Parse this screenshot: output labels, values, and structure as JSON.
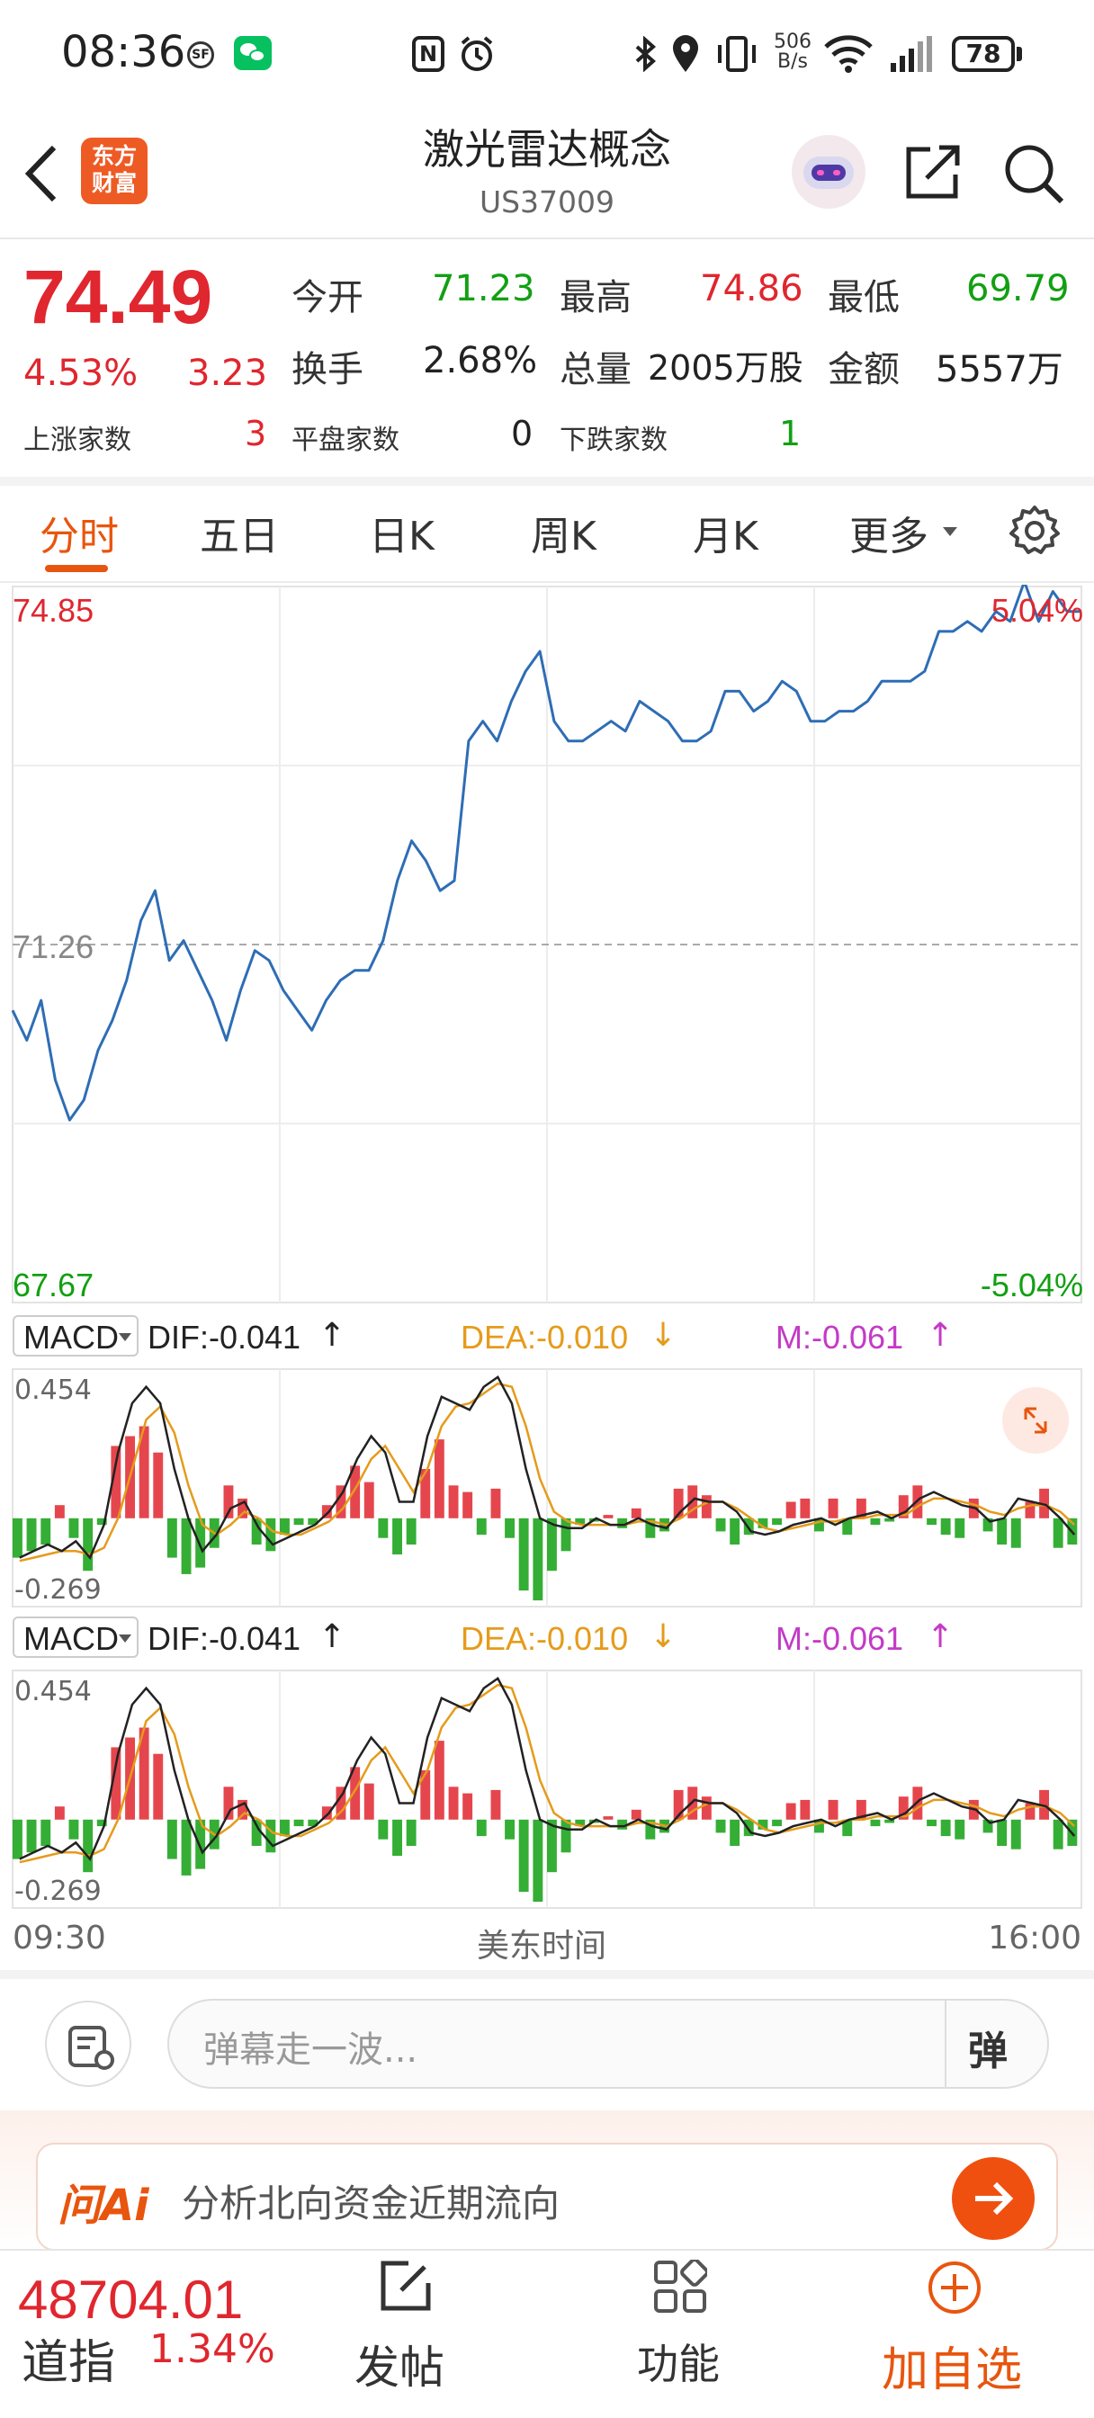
{
  "status_bar": {
    "time": "08:36",
    "net_speed_top": "506",
    "net_speed_bottom": "B/s",
    "battery": "78"
  },
  "header": {
    "title": "激光雷达概念",
    "code": "US37009"
  },
  "quote": {
    "price": "74.49",
    "change_pct": "4.53%",
    "change_val": "3.23",
    "open_label": "今开",
    "open": "71.23",
    "high_label": "最高",
    "high": "74.86",
    "low_label": "最低",
    "low": "69.79",
    "turnover_label": "换手",
    "turnover": "2.68%",
    "volume_label": "总量",
    "volume": "2005万股",
    "amount_label": "金额",
    "amount": "5557万",
    "up_label": "上涨家数",
    "up": "3",
    "flat_label": "平盘家数",
    "flat": "0",
    "down_label": "下跌家数",
    "down": "1"
  },
  "tabs": [
    "分时",
    "五日",
    "日K",
    "周K",
    "月K",
    "更多"
  ],
  "chart_data": {
    "type": "line",
    "ylim": [
      67.67,
      74.85
    ],
    "reference": 71.26,
    "y_top_label": "74.85",
    "y_mid_label": "71.26",
    "y_bottom_label": "67.67",
    "pct_top_label": "5.04%",
    "pct_bottom_label": "-5.04%",
    "x_start_label": "09:30",
    "x_mid_label": "美东时间",
    "x_end_label": "16:00",
    "price_series": [
      70.6,
      70.3,
      70.7,
      69.9,
      69.5,
      69.7,
      70.2,
      70.5,
      70.9,
      71.5,
      71.8,
      71.1,
      71.3,
      71.0,
      70.7,
      70.3,
      70.8,
      71.2,
      71.1,
      70.8,
      70.6,
      70.4,
      70.7,
      70.9,
      71.0,
      71.0,
      71.3,
      71.9,
      72.3,
      72.1,
      71.8,
      71.9,
      73.3,
      73.5,
      73.3,
      73.7,
      74.0,
      74.2,
      73.5,
      73.3,
      73.3,
      73.4,
      73.5,
      73.4,
      73.7,
      73.6,
      73.5,
      73.3,
      73.3,
      73.4,
      73.8,
      73.8,
      73.6,
      73.7,
      73.9,
      73.8,
      73.5,
      73.5,
      73.6,
      73.6,
      73.7,
      73.9,
      73.9,
      73.9,
      74.0,
      74.4,
      74.4,
      74.5,
      74.4,
      74.6,
      74.5,
      74.9,
      74.5,
      74.8,
      74.6,
      74.6
    ],
    "macd": {
      "selector": "MACD",
      "dif": "DIF:-0.041",
      "dea": "DEA:-0.010",
      "m": "M:-0.061",
      "top_label": "0.454",
      "bottom_label": "-0.269",
      "ylim": [
        -0.269,
        0.454
      ],
      "hist": [
        -0.12,
        -0.1,
        -0.08,
        0.04,
        -0.06,
        -0.16,
        -0.02,
        0.22,
        0.25,
        0.28,
        0.2,
        -0.12,
        -0.17,
        -0.15,
        -0.09,
        0.1,
        0.06,
        -0.08,
        -0.1,
        -0.05,
        -0.02,
        -0.02,
        0.04,
        0.1,
        0.16,
        0.11,
        -0.06,
        -0.11,
        -0.08,
        0.15,
        0.24,
        0.1,
        0.08,
        -0.05,
        0.09,
        -0.06,
        -0.22,
        -0.25,
        -0.16,
        -0.1,
        -0.02,
        -0.01,
        0.01,
        -0.03,
        0.03,
        -0.06,
        -0.04,
        0.09,
        0.1,
        0.07,
        -0.04,
        -0.08,
        -0.05,
        -0.03,
        -0.02,
        0.05,
        0.06,
        -0.04,
        0.06,
        -0.05,
        0.06,
        -0.02,
        -0.01,
        0.07,
        0.1,
        -0.02,
        -0.05,
        -0.06,
        0.06,
        -0.04,
        -0.08,
        -0.09,
        0.05,
        0.09,
        -0.09,
        -0.08
      ],
      "dif_series": [
        -0.12,
        -0.1,
        -0.08,
        -0.1,
        -0.07,
        -0.12,
        -0.02,
        0.2,
        0.35,
        0.4,
        0.35,
        0.15,
        0.0,
        -0.1,
        -0.05,
        0.03,
        0.05,
        -0.03,
        -0.08,
        -0.06,
        -0.04,
        -0.02,
        0.02,
        0.08,
        0.18,
        0.25,
        0.2,
        0.05,
        0.05,
        0.25,
        0.37,
        0.35,
        0.33,
        0.4,
        0.43,
        0.35,
        0.15,
        0.0,
        -0.02,
        -0.03,
        -0.03,
        0.0,
        -0.02,
        -0.02,
        0.0,
        -0.02,
        -0.03,
        0.02,
        0.06,
        0.05,
        0.05,
        0.02,
        -0.04,
        -0.05,
        -0.04,
        -0.02,
        -0.01,
        0.0,
        -0.02,
        0.0,
        0.01,
        0.02,
        0.0,
        0.02,
        0.06,
        0.08,
        0.06,
        0.04,
        0.03,
        -0.01,
        0.0,
        0.06,
        0.05,
        0.04,
        0.0,
        -0.05
      ],
      "dea_series": [
        -0.13,
        -0.12,
        -0.11,
        -0.1,
        -0.1,
        -0.11,
        -0.09,
        0.0,
        0.15,
        0.3,
        0.34,
        0.26,
        0.1,
        -0.02,
        -0.05,
        -0.02,
        0.02,
        0.0,
        -0.04,
        -0.05,
        -0.05,
        -0.03,
        -0.01,
        0.03,
        0.1,
        0.18,
        0.22,
        0.15,
        0.08,
        0.15,
        0.28,
        0.34,
        0.35,
        0.38,
        0.41,
        0.4,
        0.28,
        0.12,
        0.02,
        -0.01,
        -0.02,
        -0.02,
        -0.02,
        -0.02,
        -0.01,
        -0.01,
        -0.02,
        0.0,
        0.03,
        0.05,
        0.05,
        0.03,
        0.0,
        -0.03,
        -0.04,
        -0.03,
        -0.02,
        -0.01,
        -0.01,
        0.0,
        0.0,
        0.01,
        0.01,
        0.01,
        0.04,
        0.06,
        0.06,
        0.05,
        0.04,
        0.02,
        0.01,
        0.03,
        0.04,
        0.04,
        0.02,
        -0.02
      ]
    }
  },
  "comment": {
    "placeholder": "弹幕走一波...",
    "danmu_btn": "弹"
  },
  "ai": {
    "logo": "问Ai",
    "prompt": "分析北向资金近期流向"
  },
  "bottom": {
    "index_value": "48704.01",
    "index_name": "道指",
    "index_pct": "1.34%",
    "post": "发帖",
    "func": "功能",
    "add": "加自选"
  },
  "colors": {
    "up": "#e0262e",
    "down": "#12a012",
    "line": "#2e6db5",
    "accent": "#e8550e",
    "dea": "#e59b1b",
    "m": "#c43ac7"
  }
}
